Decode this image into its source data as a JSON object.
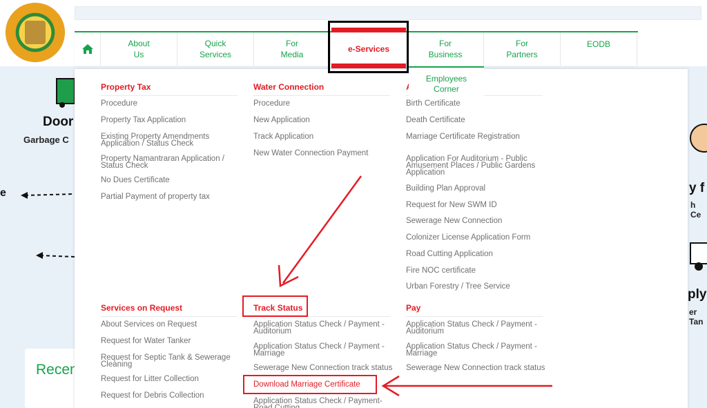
{
  "nav": {
    "items": [
      {
        "label": "About\nUs"
      },
      {
        "label": "Quick\nServices"
      },
      {
        "label": "For\nMedia"
      },
      {
        "label": "e-Services"
      },
      {
        "label": "For\nBusiness"
      },
      {
        "label": "For\nPartners"
      },
      {
        "label": "EODB"
      }
    ],
    "sub_tab": "Employees\nCorner"
  },
  "background": {
    "door": "Door",
    "garbage": "Garbage C",
    "right_a": "y f",
    "right_b": "h Ce",
    "right_c": "ply",
    "right_d": "er Tan",
    "left_e": "e",
    "recent": "Recen"
  },
  "menu": {
    "property_tax": {
      "title": "Property Tax",
      "items": [
        "Procedure",
        "Property Tax Application",
        "Existing Property Amendments\nApplication / Status Check",
        "Property Namantraran Application /\nStatus Check",
        "No Dues Certificate",
        "Partial Payment of property tax"
      ]
    },
    "water_connection": {
      "title": "Water Connection",
      "items": [
        "Procedure",
        "New Application",
        "Track Application",
        "New Water Connection Payment"
      ]
    },
    "col3": {
      "title": "A",
      "items": [
        "Birth Certificate",
        "Death Certificate",
        "Marriage Certificate Registration",
        "Application For Auditorium - Public\nAmusement Places / Public Gardens\nApplication",
        "Building Plan Approval",
        "Request for New SWM ID",
        "Sewerage New Connection",
        "Colonizer License Application Form",
        "Road Cutting Application",
        "Fire NOC certificate",
        "Urban Forestry / Tree Service"
      ]
    },
    "services_on_request": {
      "title": "Services on Request",
      "items": [
        "About Services on Request",
        "Request for Water Tanker",
        "Request for Septic Tank & Sewerage\nCleaning",
        "Request for Litter Collection",
        "Request for Debris Collection"
      ]
    },
    "track_status": {
      "title": "Track Status",
      "items": [
        "Application Status Check / Payment -\nAuditorium",
        "Application Status Check / Payment -\nMarriage",
        "Sewerage New Connection track status",
        "Download Marriage Certificate",
        "Application Status Check / Payment-\nRoad Cutting"
      ]
    },
    "pay": {
      "title": "Pay",
      "items": [
        "Application Status Check / Payment -\nAuditorium",
        "Application Status Check / Payment -\nMarriage",
        "Sewerage New Connection track status"
      ]
    }
  },
  "colors": {
    "accent_green": "#16a34a",
    "accent_red": "#e31b23",
    "text_gray": "#707070"
  },
  "icons": [
    "home-icon",
    "logo-emblem"
  ]
}
